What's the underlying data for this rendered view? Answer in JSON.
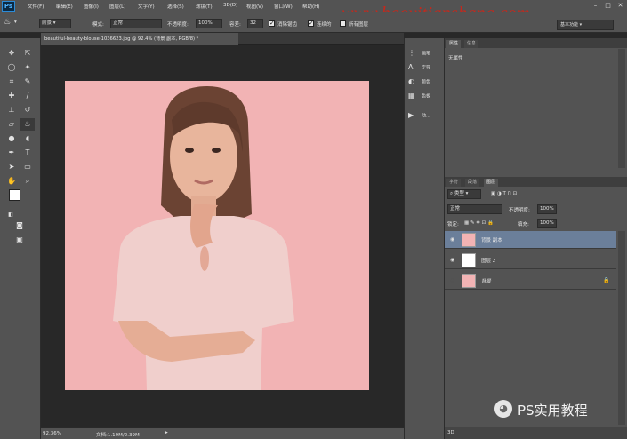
{
  "app": {
    "logo": "Ps"
  },
  "menu": [
    "文件(F)",
    "编辑(E)",
    "图像(I)",
    "图层(L)",
    "文字(Y)",
    "选择(S)",
    "滤镜(T)",
    "3D(D)",
    "视图(V)",
    "窗口(W)",
    "帮助(H)"
  ],
  "watermark": "www.haoyitianshang.com",
  "options": {
    "preset": "前景",
    "mode_label": "模式:",
    "mode_value": "正常",
    "opacity_label": "不透明度:",
    "opacity_value": "100%",
    "tolerance_label": "容差:",
    "tolerance_value": "32",
    "antialias_label": "消除锯齿",
    "contiguous_label": "连续的",
    "all_layers_label": "所有图层",
    "workspace": "基本功能"
  },
  "document": {
    "tab_title": "beautiful-beauty-blouse-1036623.jpg @ 92.4% (背景 副本, RGB/8) *",
    "zoom": "92.36%",
    "doc_size": "文档:1.19M/2.39M"
  },
  "colors": {
    "foreground": "#ffffff",
    "background": "#b07d78",
    "canvas_bg": "#f2b3b4"
  },
  "mid_panel": [
    "画笔",
    "字符",
    "颜色",
    "色板",
    "动..."
  ],
  "properties": {
    "tabs": [
      "属性",
      "信息"
    ],
    "content": "无属性"
  },
  "layers_panel": {
    "tabs": [
      "字符",
      "段落",
      "图层"
    ],
    "filter": "类型",
    "blend_mode": "正常",
    "opacity_label": "不透明度:",
    "opacity_value": "100%",
    "lock_label": "锁定:",
    "fill_label": "填充:",
    "fill_value": "100%",
    "layers": [
      {
        "name": "背景 副本",
        "visible": true,
        "selected": true,
        "thumb": "photo"
      },
      {
        "name": "图层 2",
        "visible": true,
        "selected": false,
        "thumb": "white"
      },
      {
        "name": "背景",
        "visible": false,
        "selected": false,
        "thumb": "photo",
        "locked": true
      }
    ],
    "footer": "3D"
  },
  "brand": "PS实用教程"
}
